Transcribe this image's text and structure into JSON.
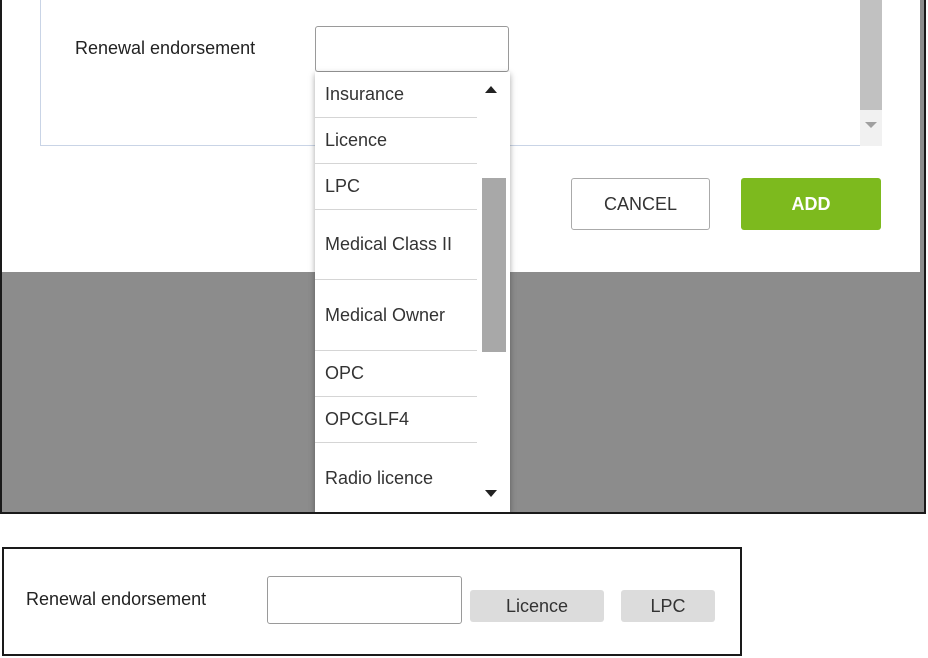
{
  "top": {
    "field_label": "Renewal endorsement",
    "select_value": "",
    "dropdown_options": [
      "Insurance",
      "Licence",
      "LPC",
      "Medical Class II",
      "Medical Owner",
      "OPC",
      "OPCGLF4",
      "Radio licence"
    ],
    "buttons": {
      "cancel": "CANCEL",
      "add": "ADD"
    }
  },
  "bottom": {
    "field_label": "Renewal endorsement",
    "input_value": "",
    "selected_chips": [
      "Licence",
      "LPC"
    ]
  },
  "colors": {
    "add_button": "#7dba1e",
    "overlay": "#8c8c8c",
    "chip": "#dcdcdc"
  }
}
